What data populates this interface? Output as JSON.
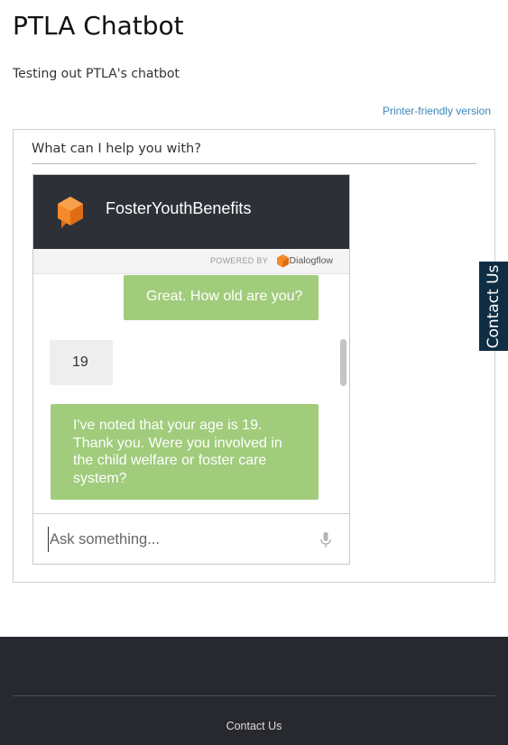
{
  "page": {
    "title": "PTLA Chatbot",
    "subtitle": "Testing out PTLA's chatbot",
    "printer_link": "Printer-friendly version"
  },
  "block": {
    "title": "What can I help you with?"
  },
  "chat": {
    "agent_name": "FosterYouthBenefits",
    "powered_by": "POWERED BY",
    "provider": "Dialogflow",
    "messages": [
      {
        "from": "bot",
        "text": "Great. How old are you?"
      },
      {
        "from": "user",
        "text": "19"
      },
      {
        "from": "bot",
        "text": "I've noted that your age is 19. Thank you. Were you involved in the child welfare or foster care system?"
      }
    ],
    "input_placeholder": "Ask something...",
    "icons": {
      "logo": "dialogflow-agent-icon",
      "mic": "microphone-icon"
    },
    "colors": {
      "header": "#2e3038",
      "bot_bubble": "#a0cc7b",
      "user_bubble": "#eeeeee"
    }
  },
  "contact_tab": {
    "label": "Contact Us",
    "color": "#0f2d43"
  },
  "footer": {
    "link": "Contact Us",
    "color": "#27292e"
  }
}
